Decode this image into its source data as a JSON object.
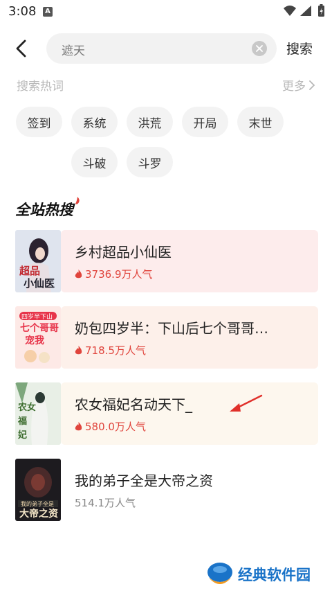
{
  "status_bar": {
    "time": "3:08",
    "notification_badge": "A",
    "icons": [
      "wifi-icon",
      "signal-icon",
      "battery-icon"
    ]
  },
  "search": {
    "query": "遮天",
    "submit_label": "搜索"
  },
  "hot_words": {
    "title": "搜索热词",
    "more_label": "更多",
    "tags": [
      "签到",
      "系统",
      "洪荒",
      "开局",
      "末世",
      "斗破",
      "斗罗"
    ]
  },
  "ranking": {
    "title": "全站热搜",
    "items": [
      {
        "title": "乡村超品小仙医",
        "popularity": "3736.9万人气",
        "pop_color": "#e0443c",
        "bg_color": "#fdecec"
      },
      {
        "title": "奶包四岁半：下山后七个哥哥…",
        "popularity": "718.5万人气",
        "pop_color": "#e0443c",
        "bg_color": "#fdf0ea"
      },
      {
        "title": "农女福妃名动天下_",
        "popularity": "580.0万人气",
        "pop_color": "#e0443c",
        "bg_color": "#fdf7ee"
      },
      {
        "title": "我的弟子全是大帝之资",
        "popularity": "514.1万人气",
        "pop_color": "#888888",
        "bg_color": "#ffffff"
      }
    ]
  },
  "watermark": {
    "text": "经典软件园"
  },
  "colors": {
    "accent": "#e0443c",
    "arrow": "#e0302a",
    "watermark": "#1a73c8"
  }
}
